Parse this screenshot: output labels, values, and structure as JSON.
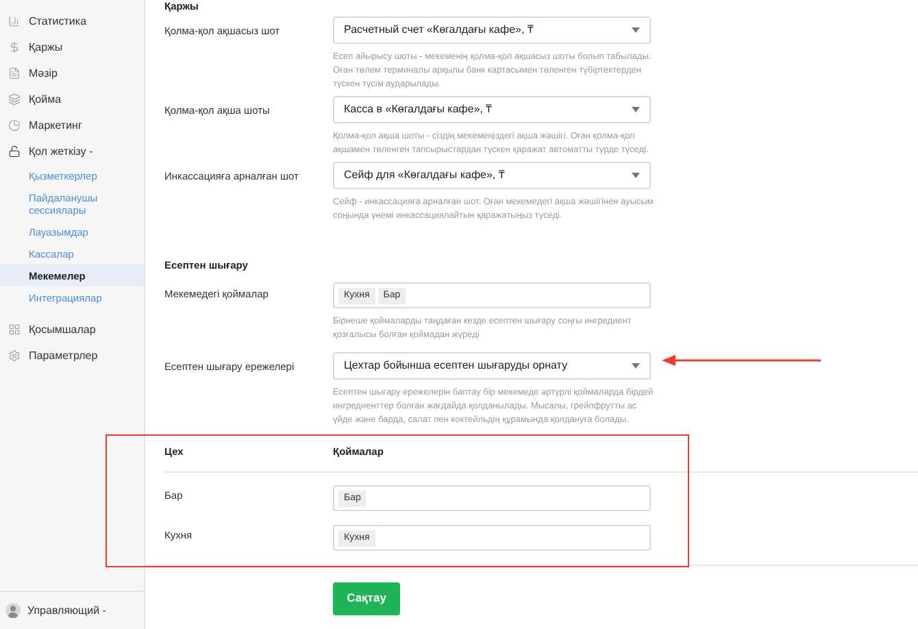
{
  "sidebar": {
    "items": [
      {
        "label": "Статистика"
      },
      {
        "label": "Қаржы"
      },
      {
        "label": "Мәзір"
      },
      {
        "label": "Қойма"
      },
      {
        "label": "Маркетинг"
      },
      {
        "label": "Қол жеткізу -",
        "expanded": true,
        "children": [
          {
            "label": "Қызметкерлер",
            "selected": false
          },
          {
            "label": "Пайдаланушы сессиялары",
            "selected": false
          },
          {
            "label": "Лауазымдар",
            "selected": false
          },
          {
            "label": "Кассалар",
            "selected": false
          },
          {
            "label": "Мекемелер",
            "selected": true
          },
          {
            "label": "Интеграциялар",
            "selected": false
          }
        ]
      },
      {
        "label": "Қосымшалар"
      },
      {
        "label": "Параметрлер"
      }
    ],
    "user": "Управляющий -"
  },
  "finance": {
    "title": "Қаржы",
    "rows": [
      {
        "label": "Қолма-қол ақшасыз шот",
        "value": "Расчетный счет «Көгалдағы кафе», ₸",
        "help": "Есеп айырысу шоты - мекеменің қолма-қол ақшасыз шоты болып табылады. Оған төлем терминалы арқылы банк картасымен төленген түбіртектерден түскен түсім аударылады."
      },
      {
        "label": "Қолма-қол ақша шоты",
        "value": "Касса в «Көгалдағы кафе», ₸",
        "help": "Қолма-қол ақша шоты - сіздің мекемеңіздегі ақша жәшігі. Оған қолма-қол ақшамен төленген тапсырыстардан түскен қаражат автоматты түрде түседі."
      },
      {
        "label": "Инкассацияға арналған шот",
        "value": "Сейф для «Көгалдағы кафе», ₸",
        "help": "Сейф - инкассацияға арналған шот. Оған мекемедегі ақша жәшігінен ауысым соңында үнемі инкассациялайтын қаражатыңыз түседі."
      }
    ]
  },
  "writeoff": {
    "title": "Есептен шығару",
    "storages": {
      "label": "Мекемедегі қоймалар",
      "tags": [
        "Кухня",
        "Бар"
      ],
      "help": "Бірнеше қоймаларды таңдаған кезде есептен шығару соңғы ингредиент қозғалысы болған қоймадан жүреді"
    },
    "rules": {
      "label": "Есептен шығару ережелері",
      "value": "Цехтар бойынша есептен шығаруды орнату",
      "help": "Есептен шығару ережелерін баптау бір мекемеде әртүрлі қоймаларда бірдей ингредиенттер болған жағдайда қолданылады. Мысалы, грейпфрутты ас үйде және барда, салат пен коктейльдің құрамында қолдануға болады."
    }
  },
  "workshops": {
    "columns": [
      "Цех",
      "Қоймалар"
    ],
    "rows": [
      {
        "name": "Бар",
        "tags": [
          "Бар"
        ]
      },
      {
        "name": "Кухня",
        "tags": [
          "Кухня"
        ]
      }
    ]
  },
  "save_button": "Сақтау"
}
